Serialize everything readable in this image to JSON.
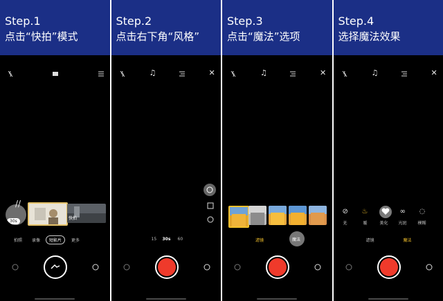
{
  "steps": [
    {
      "label": "Step.1",
      "desc": "点击“快拍”模式"
    },
    {
      "label": "Step.2",
      "desc": "点击右下角“风格”"
    },
    {
      "label": "Step.3",
      "desc": "点击“魔法”选项"
    },
    {
      "label": "Step.4",
      "desc": "选择魔法效果"
    }
  ],
  "panel1": {
    "modes": [
      "拍照",
      "录像",
      "短影片",
      "更多"
    ],
    "selected_mode": "短影片",
    "thumb_caption": "快拍",
    "thumb_badge": "30s"
  },
  "panel2": {
    "durations": [
      "15",
      "30s",
      "60"
    ]
  },
  "panel3": {
    "tabs": [
      "滤镜",
      "魔法"
    ]
  },
  "panel4": {
    "effects": [
      "无",
      "暖",
      "美化",
      "光斑",
      "模糊"
    ],
    "tabs": [
      "滤镜",
      "魔法"
    ]
  },
  "colors": {
    "header": "#1b2f86",
    "shutter": "#ef3a2b",
    "accent": "#f3c12c"
  }
}
